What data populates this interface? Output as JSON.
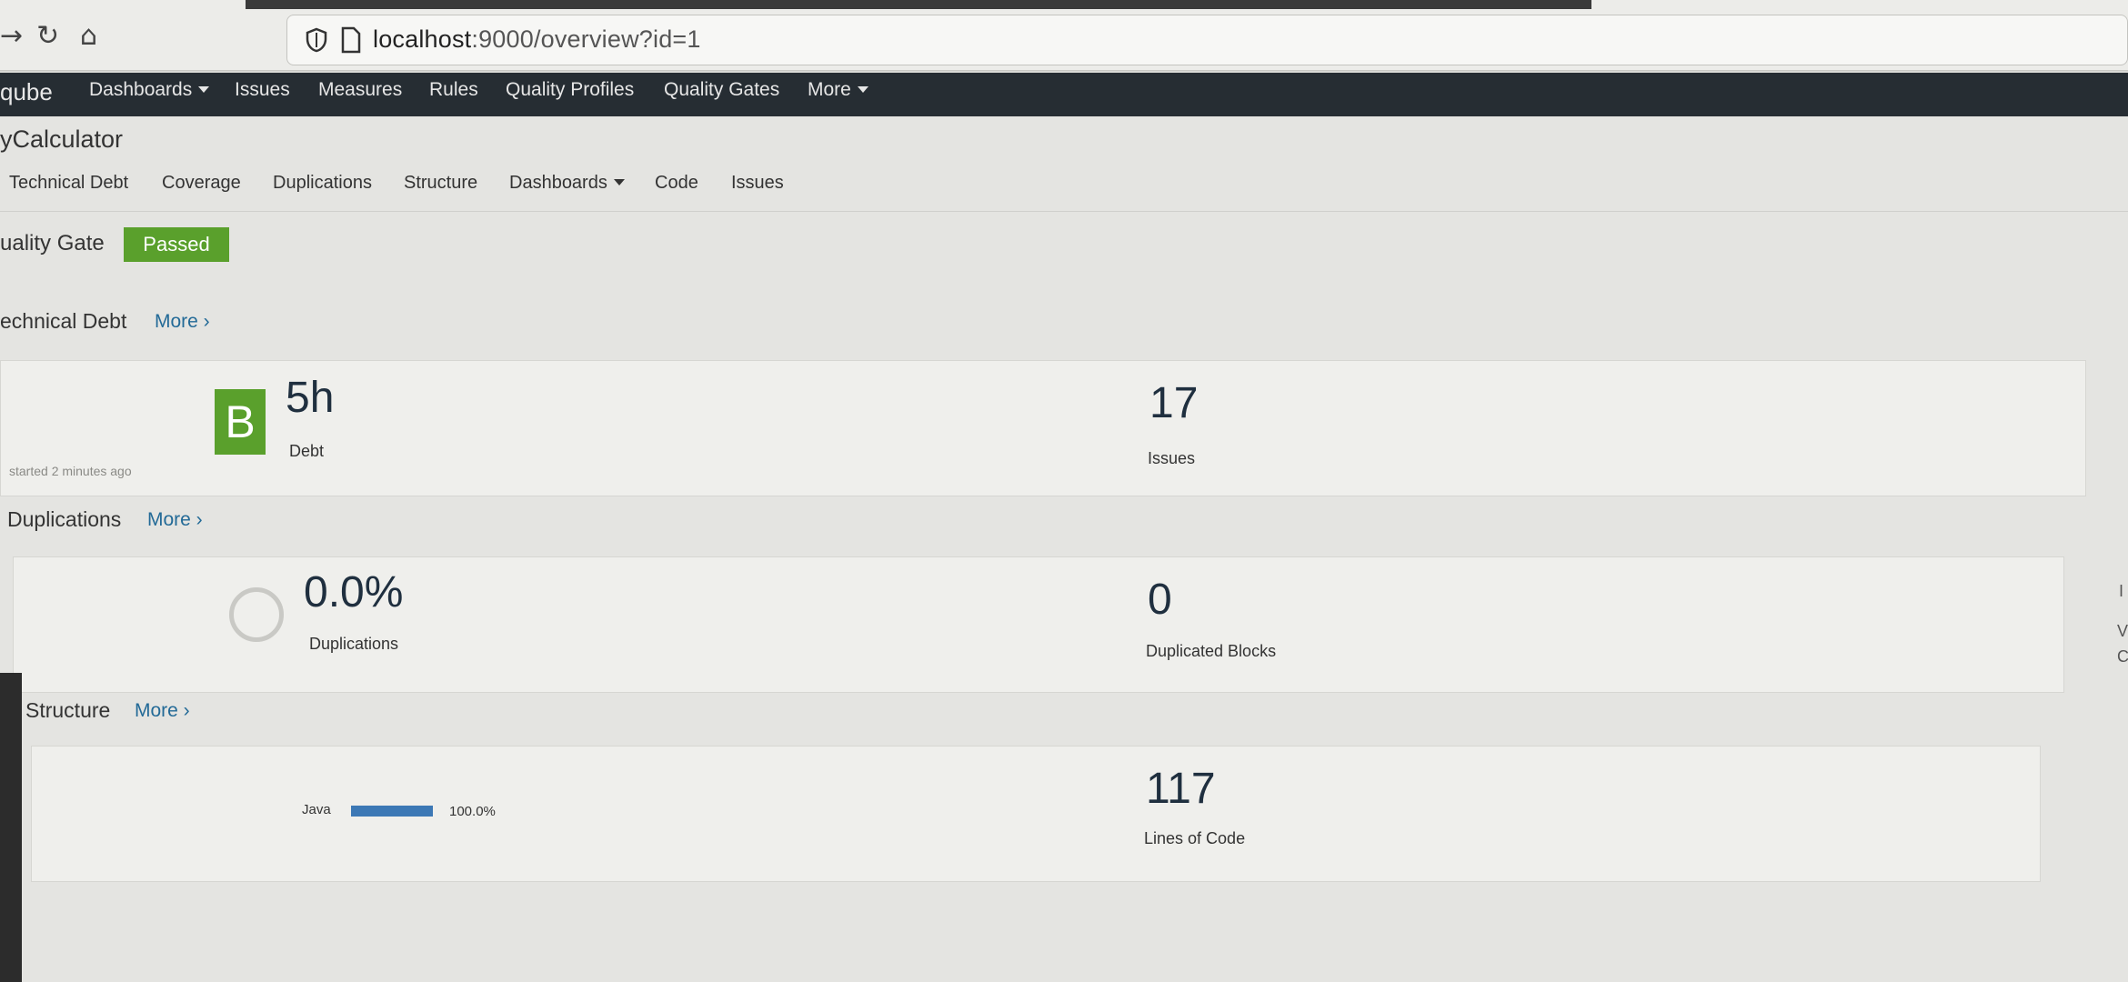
{
  "browser": {
    "back_icon": "arrow-right",
    "reload_icon": "reload",
    "home_icon": "home",
    "url_host": "localhost",
    "url_rest": ":9000/overview?id=1"
  },
  "sonar_nav": {
    "logo": "qube",
    "items": [
      "Dashboards",
      "Issues",
      "Measures",
      "Rules",
      "Quality Profiles",
      "Quality Gates",
      "More"
    ]
  },
  "project": {
    "title": "yCalculator",
    "subnav": [
      "Technical Debt",
      "Coverage",
      "Duplications",
      "Structure",
      "Dashboards",
      "Code",
      "Issues"
    ]
  },
  "quality_gate": {
    "label": "uality Gate",
    "status": "Passed",
    "status_color": "#5aa02c"
  },
  "technical_debt": {
    "title": "echnical Debt",
    "more": "More ›",
    "rating": "B",
    "debt_value": "5h",
    "debt_label": "Debt",
    "started": "started 2 minutes ago",
    "issues_value": "17",
    "issues_label": "Issues"
  },
  "duplications": {
    "title": "Duplications",
    "more": "More ›",
    "percent": "0.0%",
    "percent_label": "Duplications",
    "blocks": "0",
    "blocks_label": "Duplicated Blocks"
  },
  "structure": {
    "title": "Structure",
    "more": "More ›",
    "language": "Java",
    "language_share": "100.0%",
    "language_fraction": 1.0,
    "loc_value": "117",
    "loc_label": "Lines of Code"
  },
  "right_edge": {
    "glyphs": [
      "I",
      "V",
      "C"
    ]
  }
}
